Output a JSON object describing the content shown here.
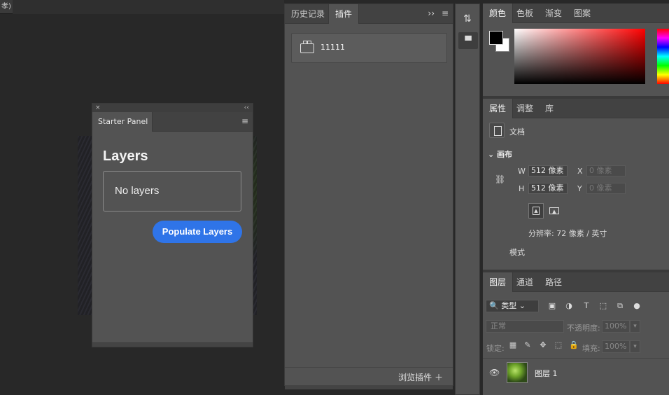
{
  "top_strip": {
    "text": "孝)"
  },
  "starter_panel": {
    "close_glyph": "×",
    "collapse_glyph": "‹‹",
    "tab_label": "Starter Panel",
    "menu_glyph": "≡",
    "heading": "Layers",
    "empty_text": "No layers",
    "button_label": "Populate Layers"
  },
  "plugins_panel": {
    "tabs": [
      {
        "label": "历史记录"
      },
      {
        "label": "插件"
      }
    ],
    "collapse_glyph": "››",
    "menu_glyph": "≡",
    "plugin_name": "11111",
    "browse_label": "浏览插件 ＋"
  },
  "side_tools": {
    "history_glyph": "⇅",
    "plugin_glyph": "▀"
  },
  "color_panel": {
    "tabs": [
      {
        "label": "颜色"
      },
      {
        "label": "色板"
      },
      {
        "label": "渐变"
      },
      {
        "label": "图案"
      }
    ],
    "foreground": "#000000",
    "background": "#ffffff"
  },
  "properties_panel": {
    "tabs": [
      {
        "label": "属性"
      },
      {
        "label": "调整"
      },
      {
        "label": "库"
      }
    ],
    "doc_label": "文档",
    "canvas_label": "⌄ 画布",
    "w_label": "W",
    "w_value": "512 像素",
    "h_label": "H",
    "h_value": "512 像素",
    "x_label": "X",
    "x_placeholder": "0 像素",
    "y_label": "Y",
    "y_placeholder": "0 像素",
    "resolution": "分辨率: 72 像素 / 英寸",
    "mode_label": "模式"
  },
  "layers_panel": {
    "tabs": [
      {
        "label": "图层"
      },
      {
        "label": "通道"
      },
      {
        "label": "路径"
      }
    ],
    "kind_filter": "🔍 类型 ⌄",
    "blend_mode": "正常",
    "opacity_label": "不透明度:",
    "opacity_value": "100%",
    "lock_label": "锁定:",
    "fill_label": "填充:",
    "fill_value": "100%",
    "layer_name": "图层 1"
  }
}
